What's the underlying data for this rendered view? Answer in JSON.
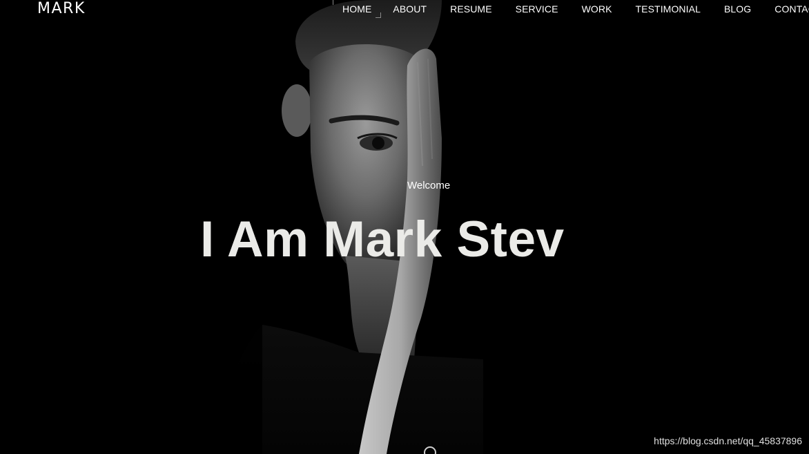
{
  "brand": {
    "logo_text": "MARK"
  },
  "nav": {
    "items": [
      {
        "label": "HOME",
        "active": true
      },
      {
        "label": "ABOUT"
      },
      {
        "label": "RESUME"
      },
      {
        "label": "SERVICE"
      },
      {
        "label": "WORK"
      },
      {
        "label": "TESTIMONIAL"
      },
      {
        "label": "BLOG"
      },
      {
        "label": "CONTACT"
      }
    ]
  },
  "hero": {
    "welcome": "Welcome",
    "headline": "I Am Mark Stev",
    "background_image": "black-and-white-portrait-man-hand-covering-face",
    "scroll_indicator_icon": "scroll-down-circle-icon"
  },
  "watermark": "https://blog.csdn.net/qq_45837896",
  "colors": {
    "background": "#000000",
    "text": "#ffffff",
    "headline": "#ebebe8"
  }
}
